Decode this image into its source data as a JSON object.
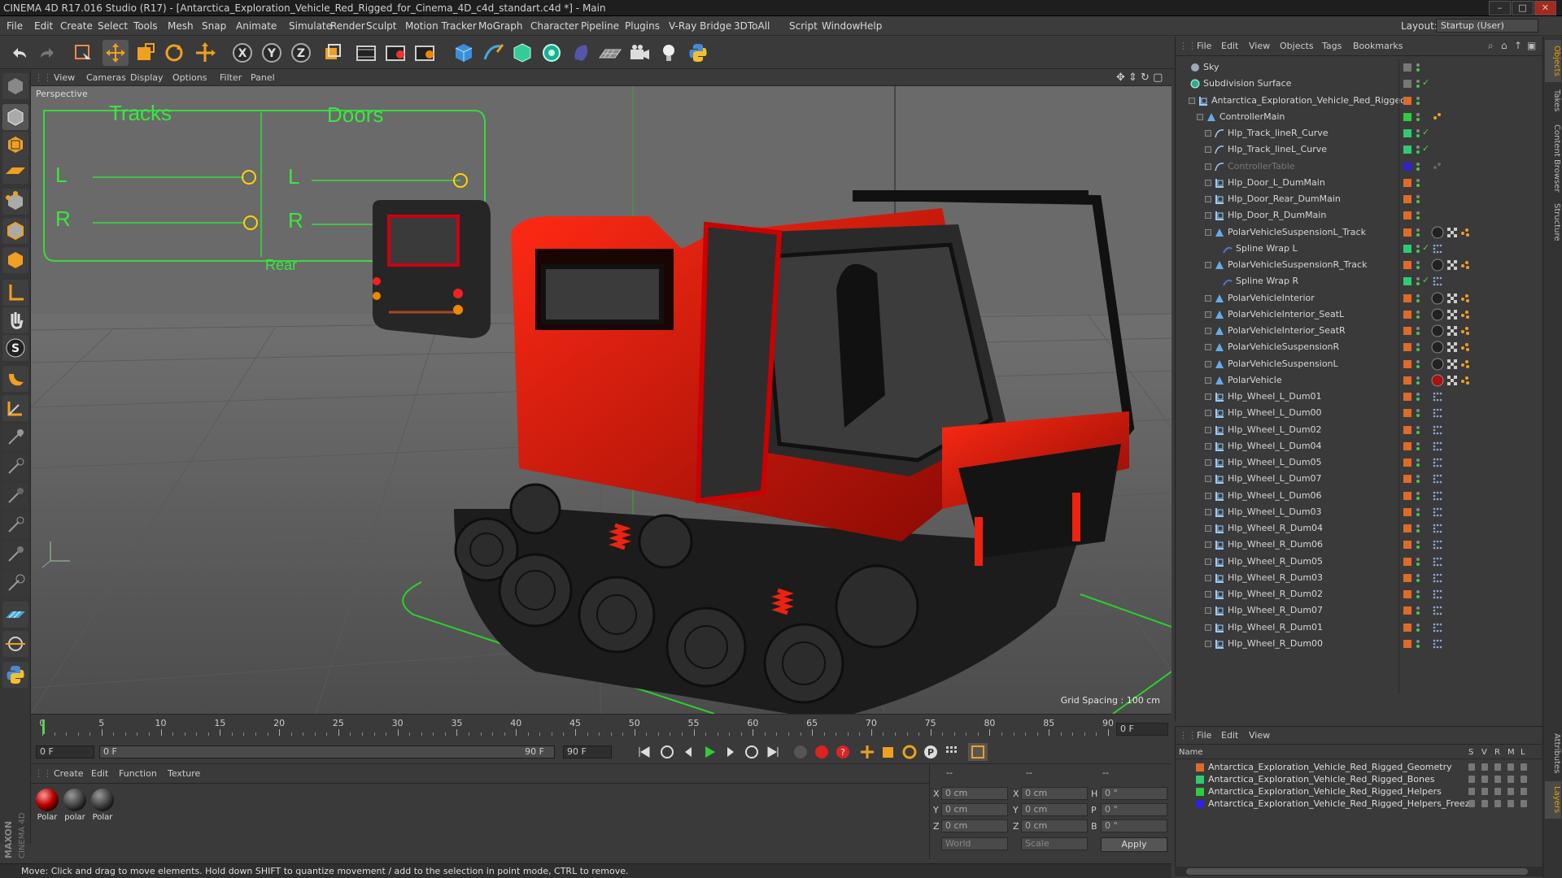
{
  "window": {
    "title": "CINEMA 4D R17.016 Studio (R17) - [Antarctica_Exploration_Vehicle_Red_Rigged_for_Cinema_4D_c4d_standart.c4d *] - Main"
  },
  "menu": [
    "File",
    "Edit",
    "Create",
    "Select",
    "Tools",
    "Mesh",
    "Snap",
    "Animate",
    "Simulate",
    "Render",
    "Sculpt",
    "Motion Tracker",
    "MoGraph",
    "Character",
    "Pipeline",
    "Plugins",
    "V-Ray Bridge",
    "3DToAll",
    "Script",
    "Window",
    "Help"
  ],
  "layout": {
    "label": "Layout:",
    "value": "Startup (User)"
  },
  "viewport": {
    "menu": [
      "View",
      "Cameras",
      "Display",
      "Options",
      "Filter",
      "Panel"
    ],
    "label": "Perspective",
    "grid_spacing": "Grid Spacing : 100 cm",
    "hud": {
      "tracks": "Tracks",
      "doors": "Doors",
      "l1": "L",
      "r1": "R",
      "l2": "L",
      "r2": "R",
      "rear": "Rear"
    }
  },
  "timeline": {
    "ticks": [
      "0",
      "5",
      "10",
      "15",
      "20",
      "25",
      "30",
      "35",
      "40",
      "45",
      "50",
      "55",
      "60",
      "65",
      "70",
      "75",
      "80",
      "85",
      "90"
    ],
    "frame": "0 F"
  },
  "transport": {
    "start": "0 F",
    "range_start": "0 F",
    "range_end": "90 F",
    "end": "90 F"
  },
  "materials": {
    "menu": [
      "Create",
      "Edit",
      "Function",
      "Texture"
    ],
    "items": [
      {
        "name": "Polar",
        "red": true
      },
      {
        "name": "polar",
        "red": false
      },
      {
        "name": "Polar",
        "red": false
      }
    ]
  },
  "coords": {
    "header": [
      "--",
      "--",
      "--"
    ],
    "rows": [
      {
        "a": "X",
        "av": "0 cm",
        "b": "X",
        "bv": "0 cm",
        "c": "H",
        "cv": "0 °"
      },
      {
        "a": "Y",
        "av": "0 cm",
        "b": "Y",
        "bv": "0 cm",
        "c": "P",
        "cv": "0 °"
      },
      {
        "a": "Z",
        "av": "0 cm",
        "b": "Z",
        "bv": "0 cm",
        "c": "B",
        "cv": "0 °"
      }
    ],
    "world": "World",
    "scale": "Scale",
    "apply": "Apply"
  },
  "status": "Move: Click and drag to move elements. Hold down SHIFT to quantize movement / add to the selection in point mode, CTRL to remove.",
  "objects": {
    "menu": [
      "File",
      "Edit",
      "View",
      "Objects",
      "Tags",
      "Bookmarks"
    ],
    "rows": [
      {
        "name": "Sky",
        "indent": 0,
        "color": "#777777",
        "icon": "sky"
      },
      {
        "name": "Subdivision Surface",
        "indent": 0,
        "color": "#777777",
        "icon": "subd",
        "check": "✓"
      },
      {
        "name": "Antarctica_Exploration_Vehicle_Red_Rigged",
        "indent": 1,
        "color": "#e06a2a",
        "icon": "null"
      },
      {
        "name": "ControllerMain",
        "indent": 2,
        "color": "#2ecc40",
        "icon": "joint",
        "tag": "orange"
      },
      {
        "name": "Hlp_Track_lineR_Curve",
        "indent": 3,
        "color": "#2ecc71",
        "icon": "spline",
        "check": "✓"
      },
      {
        "name": "Hlp_Track_lineL_Curve",
        "indent": 3,
        "color": "#2ecc71",
        "icon": "spline",
        "check": "✓"
      },
      {
        "name": "ControllerTable",
        "indent": 3,
        "color": "#3322cc",
        "icon": "spline",
        "dim": true,
        "tag": "grey"
      },
      {
        "name": "Hlp_Door_L_DumMain",
        "indent": 3,
        "color": "#e06a2a",
        "icon": "null"
      },
      {
        "name": "Hlp_Door_Rear_DumMain",
        "indent": 3,
        "color": "#e06a2a",
        "icon": "null"
      },
      {
        "name": "Hlp_Door_R_DumMain",
        "indent": 3,
        "color": "#e06a2a",
        "icon": "null"
      },
      {
        "name": "PolarVehicleSuspensionL_Track",
        "indent": 3,
        "color": "#e06a2a",
        "icon": "poly",
        "tag": "mat"
      },
      {
        "name": "Spline Wrap L",
        "indent": 4,
        "color": "#2ecc71",
        "icon": "wrap",
        "check": "✓",
        "tag": "dots"
      },
      {
        "name": "PolarVehicleSuspensionR_Track",
        "indent": 3,
        "color": "#e06a2a",
        "icon": "poly",
        "tag": "mat"
      },
      {
        "name": "Spline Wrap R",
        "indent": 4,
        "color": "#2ecc71",
        "icon": "wrap",
        "check": "✓",
        "tag": "dots"
      },
      {
        "name": "PolarVehicleInterior",
        "indent": 3,
        "color": "#e06a2a",
        "icon": "poly",
        "tag": "mat"
      },
      {
        "name": "PolarVehicleInterior_SeatL",
        "indent": 3,
        "color": "#e06a2a",
        "icon": "poly",
        "tag": "mat"
      },
      {
        "name": "PolarVehicleInterior_SeatR",
        "indent": 3,
        "color": "#e06a2a",
        "icon": "poly",
        "tag": "mat"
      },
      {
        "name": "PolarVehicleSuspensionR",
        "indent": 3,
        "color": "#e06a2a",
        "icon": "poly",
        "tag": "mat"
      },
      {
        "name": "PolarVehicleSuspensionL",
        "indent": 3,
        "color": "#e06a2a",
        "icon": "poly",
        "tag": "mat"
      },
      {
        "name": "PolarVehicle",
        "indent": 3,
        "color": "#e06a2a",
        "icon": "poly",
        "tag": "matred"
      },
      {
        "name": "Hlp_Wheel_L_Dum01",
        "indent": 3,
        "color": "#e06a2a",
        "icon": "null",
        "tag": "dots"
      },
      {
        "name": "Hlp_Wheel_L_Dum00",
        "indent": 3,
        "color": "#e06a2a",
        "icon": "null",
        "tag": "dots"
      },
      {
        "name": "Hlp_Wheel_L_Dum02",
        "indent": 3,
        "color": "#e06a2a",
        "icon": "null",
        "tag": "dots"
      },
      {
        "name": "Hlp_Wheel_L_Dum04",
        "indent": 3,
        "color": "#e06a2a",
        "icon": "null",
        "tag": "dots"
      },
      {
        "name": "Hlp_Wheel_L_Dum05",
        "indent": 3,
        "color": "#e06a2a",
        "icon": "null",
        "tag": "dots"
      },
      {
        "name": "Hlp_Wheel_L_Dum07",
        "indent": 3,
        "color": "#e06a2a",
        "icon": "null",
        "tag": "dots"
      },
      {
        "name": "Hlp_Wheel_L_Dum06",
        "indent": 3,
        "color": "#e06a2a",
        "icon": "null",
        "tag": "dots"
      },
      {
        "name": "Hlp_Wheel_L_Dum03",
        "indent": 3,
        "color": "#e06a2a",
        "icon": "null",
        "tag": "dots"
      },
      {
        "name": "Hlp_Wheel_R_Dum04",
        "indent": 3,
        "color": "#e06a2a",
        "icon": "null",
        "tag": "dots"
      },
      {
        "name": "Hlp_Wheel_R_Dum06",
        "indent": 3,
        "color": "#e06a2a",
        "icon": "null",
        "tag": "dots"
      },
      {
        "name": "Hlp_Wheel_R_Dum05",
        "indent": 3,
        "color": "#e06a2a",
        "icon": "null",
        "tag": "dots"
      },
      {
        "name": "Hlp_Wheel_R_Dum03",
        "indent": 3,
        "color": "#e06a2a",
        "icon": "null",
        "tag": "dots"
      },
      {
        "name": "Hlp_Wheel_R_Dum02",
        "indent": 3,
        "color": "#e06a2a",
        "icon": "null",
        "tag": "dots"
      },
      {
        "name": "Hlp_Wheel_R_Dum07",
        "indent": 3,
        "color": "#e06a2a",
        "icon": "null",
        "tag": "dots"
      },
      {
        "name": "Hlp_Wheel_R_Dum01",
        "indent": 3,
        "color": "#e06a2a",
        "icon": "null",
        "tag": "dots"
      },
      {
        "name": "Hlp_Wheel_R_Dum00",
        "indent": 3,
        "color": "#e06a2a",
        "icon": "null",
        "tag": "dots"
      }
    ]
  },
  "layers": {
    "menu": [
      "File",
      "Edit",
      "View"
    ],
    "header": {
      "name": "Name",
      "s": "S",
      "v": "V",
      "r": "R",
      "m": "M",
      "l": "L"
    },
    "rows": [
      {
        "name": "Antarctica_Exploration_Vehicle_Red_Rigged_Geometry",
        "color": "#e06a2a"
      },
      {
        "name": "Antarctica_Exploration_Vehicle_Red_Rigged_Bones",
        "color": "#2ecc71"
      },
      {
        "name": "Antarctica_Exploration_Vehicle_Red_Rigged_Helpers",
        "color": "#2ecc40"
      },
      {
        "name": "Antarctica_Exploration_Vehicle_Red_Rigged_Helpers_Freeze",
        "color": "#3322dd"
      }
    ]
  },
  "side_tabs": [
    "Objects",
    "Takes",
    "Content Browser",
    "Structure"
  ],
  "side_tabs2": [
    "Attributes",
    "Layers"
  ],
  "brand": "MAXON CINEMA 4D"
}
